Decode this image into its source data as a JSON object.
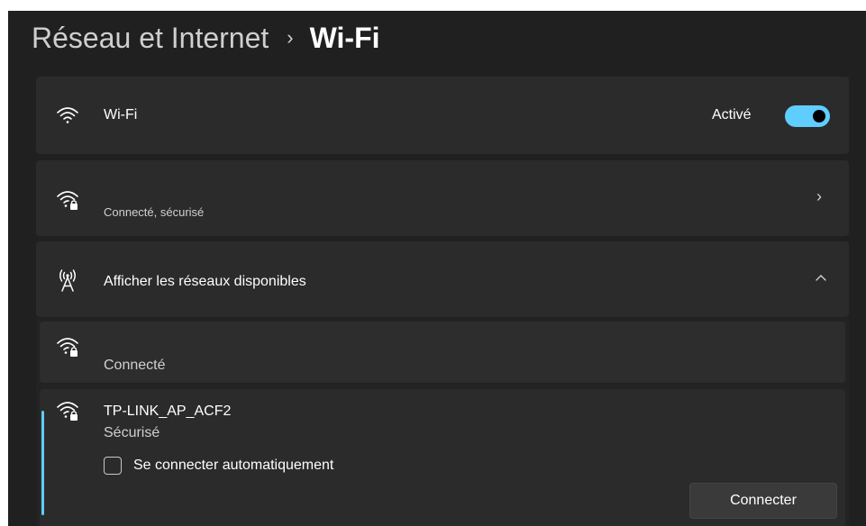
{
  "breadcrumb": {
    "parent": "Réseau et Internet",
    "separator": "›",
    "current": "Wi-Fi"
  },
  "wifi_card": {
    "label": "Wi-Fi",
    "toggle_state_text": "Activé",
    "toggle_on": true,
    "icon": "wifi-icon"
  },
  "connected_card": {
    "status": "Connecté, sécurisé",
    "icon": "wifi-lock-icon",
    "chevron": "›"
  },
  "available_card": {
    "label": "Afficher les réseaux disponibles",
    "icon": "antenna-icon",
    "chevron": "^"
  },
  "networks": [
    {
      "name": "",
      "status": "Connecté",
      "icon": "wifi-lock-icon"
    },
    {
      "name": "TP-LINK_AP_ACF2",
      "status": "Sécurisé",
      "icon": "wifi-lock-icon",
      "auto_connect_label": "Se connecter automatiquement",
      "auto_connect_checked": false,
      "connect_label": "Connecter"
    }
  ],
  "colors": {
    "accent": "#60cdff",
    "background": "#202020",
    "card": "#2b2b2b"
  }
}
